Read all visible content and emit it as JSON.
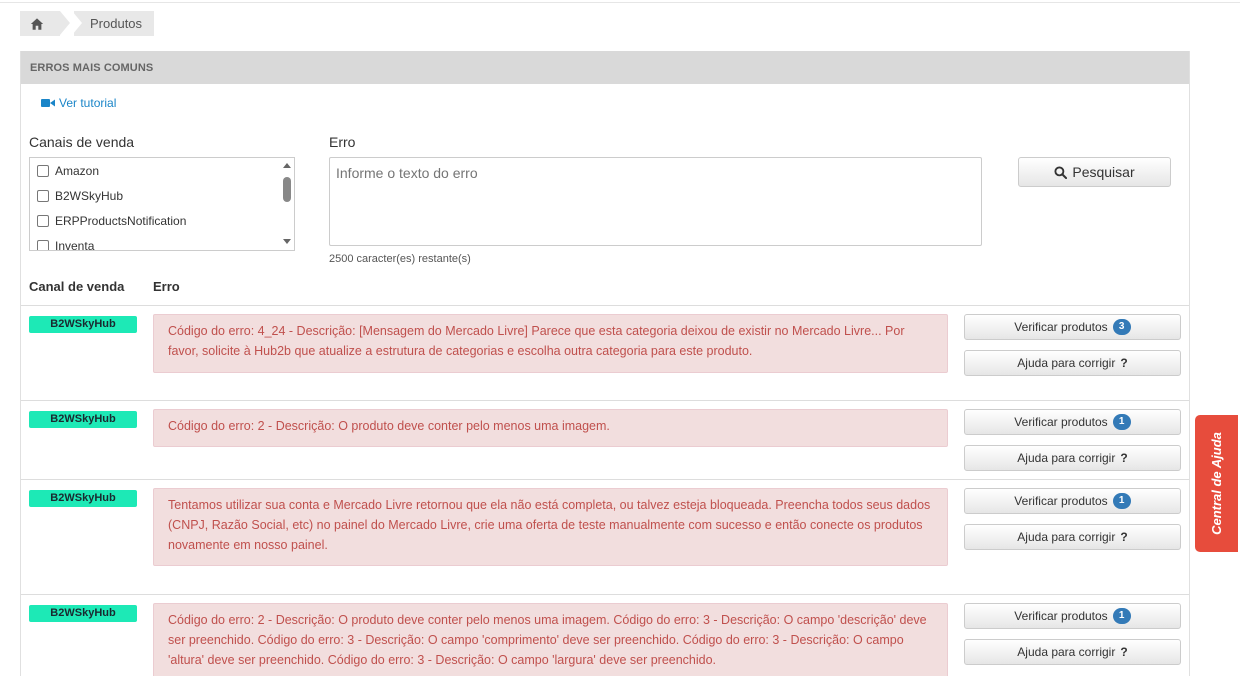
{
  "breadcrumb": {
    "home_icon": "home-icon",
    "current": "Produtos"
  },
  "panel": {
    "title": "ERROS MAIS COMUNS",
    "tutorial_link": "Ver tutorial",
    "tutorial_icon": "video-camera-icon"
  },
  "filters": {
    "channels_label": "Canais de venda",
    "channels": [
      "Amazon",
      "B2WSkyHub",
      "ERPProductsNotification",
      "Inventa"
    ],
    "error_label": "Erro",
    "error_placeholder": "Informe o texto do erro",
    "remaining": "2500 caracter(es) restante(s)",
    "search_button": "Pesquisar",
    "search_icon": "search-icon"
  },
  "table": {
    "col_channel": "Canal de venda",
    "col_error": "Erro",
    "verify_label": "Verificar produtos",
    "help_label": "Ajuda para corrigir",
    "help_mark": "?",
    "badge_color": "#1de9b6",
    "rows": [
      {
        "channel": "B2WSkyHub",
        "error": "Código do erro: 4_24 - Descrição: [Mensagem do Mercado Livre] Parece que esta categoria deixou de existir no Mercado Livre... Por favor, solicite à Hub2b que atualize a estrutura de categorias e escolha outra categoria para este produto.",
        "count": "3"
      },
      {
        "channel": "B2WSkyHub",
        "error": "Código do erro: 2 - Descrição: O produto deve conter pelo menos uma imagem.",
        "count": "1"
      },
      {
        "channel": "B2WSkyHub",
        "error": "Tentamos utilizar sua conta e Mercado Livre retornou que ela não está completa, ou talvez esteja bloqueada. Preencha todos seus dados (CNPJ, Razão Social, etc) no painel do Mercado Livre, crie uma oferta de teste manualmente com sucesso e então conecte os produtos novamente em nosso painel.",
        "count": "1"
      },
      {
        "channel": "B2WSkyHub",
        "error": "Código do erro: 2 - Descrição: O produto deve conter pelo menos uma imagem. Código do erro: 3 - Descrição: O campo 'descrição' deve ser preenchido. Código do erro: 3 - Descrição: O campo 'comprimento' deve ser preenchido. Código do erro: 3 - Descrição: O campo 'altura' deve ser preenchido. Código do erro: 3 - Descrição: O campo 'largura' deve ser preenchido.",
        "count": "1"
      }
    ]
  },
  "help_tab": {
    "label": "Central de Ajuda",
    "color": "#e74c3c"
  }
}
